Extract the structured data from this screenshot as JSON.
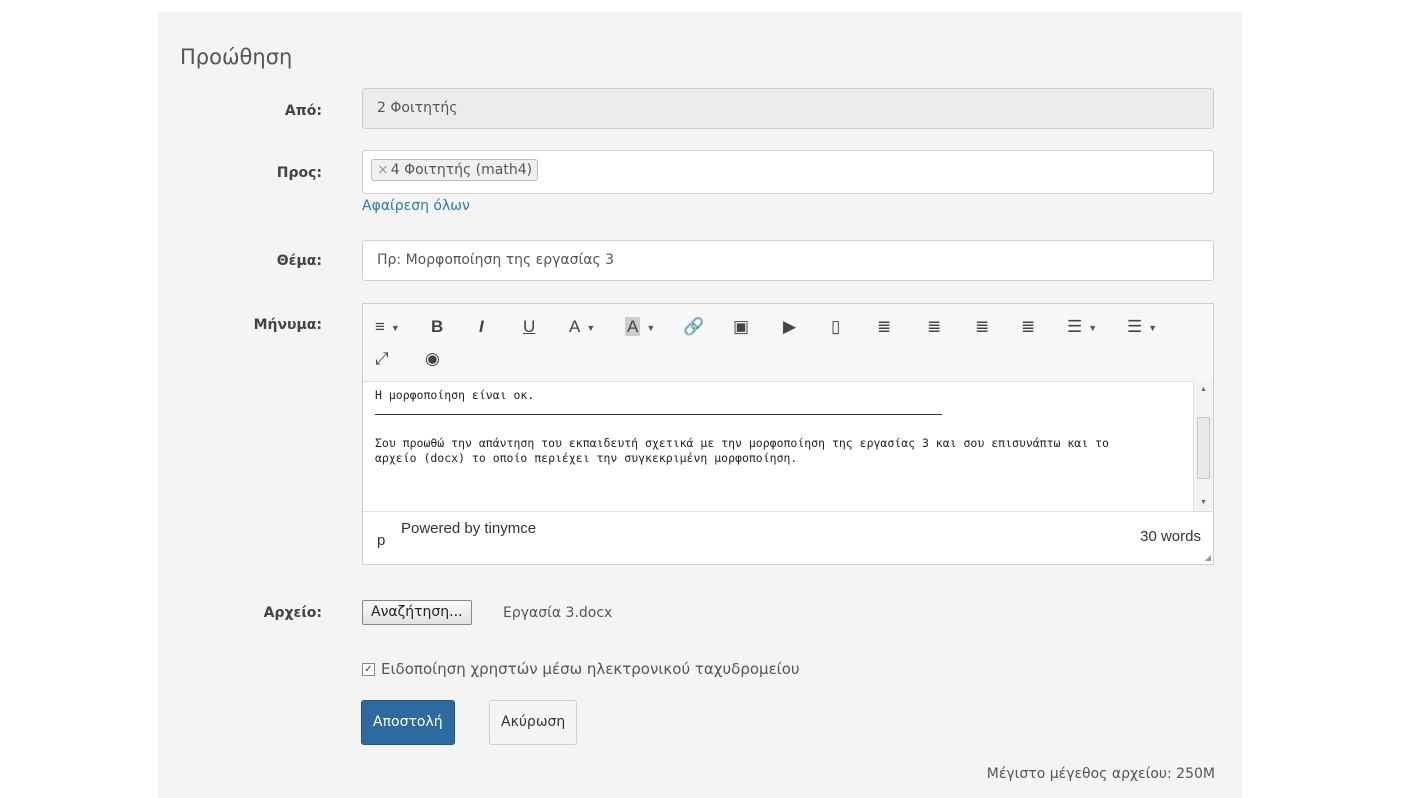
{
  "form": {
    "heading": "Προώθηση",
    "from": {
      "label": "Από:",
      "value": "2 Φοιτητής"
    },
    "to": {
      "label": "Προς:",
      "chip_remove": "×",
      "chip_label": "4 Φοιτητής (math4)",
      "remove_all": "Αφαίρεση όλων"
    },
    "subject": {
      "label": "Θέμα:",
      "value": "Πρ: Μορφοποίηση της εργασίας 3"
    },
    "message": {
      "label": "Μήνυμα:",
      "toolbar": [
        {
          "icon": "paragraph-format-icon",
          "glyph": "≡",
          "dropdown": true
        },
        {
          "icon": "bold-icon",
          "glyph": "B"
        },
        {
          "icon": "italic-icon",
          "glyph": "I"
        },
        {
          "icon": "underline-icon",
          "glyph": "U"
        },
        {
          "icon": "font-color-icon",
          "glyph": "A",
          "dropdown": true
        },
        {
          "icon": "background-color-icon",
          "glyph": "A",
          "dropdown": true
        },
        {
          "icon": "link-icon",
          "glyph": "🔗"
        },
        {
          "icon": "image-icon",
          "glyph": "▣"
        },
        {
          "icon": "media-icon",
          "glyph": "▶"
        },
        {
          "icon": "bookmark-icon",
          "glyph": "▯"
        },
        {
          "icon": "align-left-icon",
          "glyph": "≣"
        },
        {
          "icon": "align-center-icon",
          "glyph": "≣"
        },
        {
          "icon": "align-right-icon",
          "glyph": "≣"
        },
        {
          "icon": "align-justify-icon",
          "glyph": "≣"
        },
        {
          "icon": "bullet-list-icon",
          "glyph": "☰",
          "dropdown": true
        },
        {
          "icon": "numbered-list-icon",
          "glyph": "☰",
          "dropdown": true
        },
        {
          "icon": "fullscreen-icon",
          "glyph": "⤢"
        },
        {
          "icon": "preview-icon",
          "glyph": "◉"
        }
      ],
      "line1": "Η μορφοποίηση είναι οκ.",
      "paragraph": "Σου προωθώ την απάντηση του εκπαιδευτή σχετικά με την μορφοποίηση  της εργασίας 3 και σου επισυνάπτω και το αρχείο (docx) το οποίο περιέχει την συγκεκριμένη μορφοποίηση.",
      "path": "p",
      "powered": "Powered by tinymce",
      "words": "30 words"
    },
    "file": {
      "label": "Αρχείο:",
      "button": "Αναζήτηση...",
      "filename": "Εργασία 3.docx"
    },
    "notify": {
      "checked": true,
      "label": "Ειδοποίηση χρηστών μέσω ηλεκτρονικού ταχυδρομείου"
    },
    "buttons": {
      "send": "Αποστολή",
      "cancel": "Ακύρωση"
    },
    "max_size": "Μέγιστο μέγεθος αρχείου: 250M"
  }
}
